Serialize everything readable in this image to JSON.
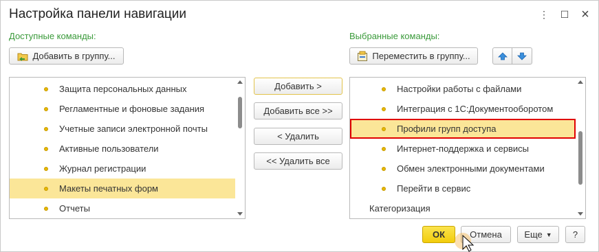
{
  "window": {
    "title": "Настройка панели навигации",
    "controls": {
      "more": "⋮",
      "maximize": "☐",
      "close": "×"
    }
  },
  "available": {
    "label": "Доступные команды:",
    "add_to_group": "Добавить в группу...",
    "items": [
      {
        "label": "Защита персональных данных",
        "selected": false
      },
      {
        "label": "Регламентные и фоновые задания",
        "selected": false
      },
      {
        "label": "Учетные записи электронной почты",
        "selected": false
      },
      {
        "label": "Активные пользователи",
        "selected": false
      },
      {
        "label": "Журнал регистрации",
        "selected": false
      },
      {
        "label": "Макеты печатных форм",
        "selected": true
      },
      {
        "label": "Отчеты",
        "selected": false
      }
    ]
  },
  "middle": {
    "add": "Добавить >",
    "add_all": "Добавить все >>",
    "remove": "< Удалить",
    "remove_all": "<< Удалить все"
  },
  "selected": {
    "label": "Выбранные команды:",
    "move_to_group": "Переместить в группу...",
    "items": [
      {
        "label": "Настройки работы с файлами",
        "selected": false
      },
      {
        "label": "Интеграция с 1С:Документооборотом",
        "selected": false
      },
      {
        "label": "Профили групп доступа",
        "selected": true
      },
      {
        "label": "Интернет-поддержка и сервисы",
        "selected": false
      },
      {
        "label": "Обмен электронными документами",
        "selected": false
      },
      {
        "label": "Перейти в сервис",
        "selected": false
      },
      {
        "label": "Категоризация",
        "selected": false,
        "group": true
      }
    ]
  },
  "footer": {
    "ok": "ОК",
    "cancel": "Отмена",
    "more": "Еще",
    "help": "?"
  },
  "colors": {
    "section_label": "#3a9a3a",
    "selection": "#fbe698",
    "highlight_border": "#e00000",
    "ok_button": "#f5d21c"
  }
}
